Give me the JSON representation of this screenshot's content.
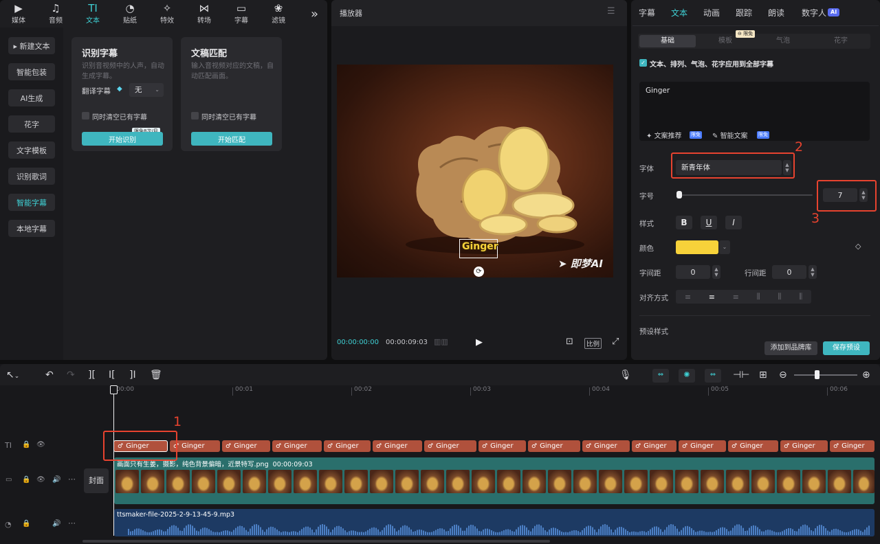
{
  "toolbar_top": [
    {
      "label": "媒体",
      "icon": "media-icon",
      "glyph": "▶"
    },
    {
      "label": "音频",
      "icon": "audio-icon",
      "glyph": "♫"
    },
    {
      "label": "文本",
      "icon": "text-icon",
      "glyph": "TI",
      "active": true
    },
    {
      "label": "贴纸",
      "icon": "sticker-icon",
      "glyph": "◔"
    },
    {
      "label": "特效",
      "icon": "effects-icon",
      "glyph": "✧"
    },
    {
      "label": "转场",
      "icon": "transition-icon",
      "glyph": "⋈"
    },
    {
      "label": "字幕",
      "icon": "subtitle-icon",
      "glyph": "▭"
    },
    {
      "label": "滤镜",
      "icon": "filter-icon",
      "glyph": "❀"
    }
  ],
  "toolbar_more_glyph": "»",
  "sidebar": [
    {
      "label": "▸ 新建文本"
    },
    {
      "label": "智能包装"
    },
    {
      "label": "AI生成"
    },
    {
      "label": "花字"
    },
    {
      "label": "文字模板"
    },
    {
      "label": "识别歌词"
    },
    {
      "label": "智能字幕",
      "active": true
    },
    {
      "label": "本地字幕"
    }
  ],
  "cards": {
    "recognize": {
      "title": "识别字幕",
      "desc": "识别音视频中的人声，自动生成字幕。",
      "translate_label": "翻译字幕",
      "translate_value": "无",
      "clear_label": "同时清空已有字幕",
      "badge": "限免8次/月",
      "button": "开始识别"
    },
    "match": {
      "title": "文稿匹配",
      "desc": "输入音视频对应的文稿，自动匹配画面。",
      "clear_label": "同时清空已有字幕",
      "button": "开始匹配"
    }
  },
  "player": {
    "title": "播放器",
    "caption": "Ginger",
    "watermark": "即梦AI",
    "time_current": "00:00:00:00",
    "time_total": "00:00:09:03",
    "ratio_label": "比例"
  },
  "right": {
    "tabs": [
      "字幕",
      "文本",
      "动画",
      "跟踪",
      "朗读",
      "数字人"
    ],
    "active_tab": "文本",
    "ai_badge": "AI",
    "subtabs": [
      "基础",
      "模板",
      "气泡",
      "花字"
    ],
    "free_badge": "限免",
    "apply_all": "文本、排列、气泡、花字应用到全部字幕",
    "text_value": "Ginger",
    "copy_suggest": "文案推荐",
    "smart_copy": "智能文案",
    "font_label": "字体",
    "font_value": "新青年体",
    "size_label": "字号",
    "size_value": "7",
    "style_label": "样式",
    "style_buttons": [
      "B",
      "U",
      "I"
    ],
    "color_label": "颜色",
    "color_value": "#f7d23a",
    "letter_spacing_label": "字间距",
    "letter_spacing_value": "0",
    "line_spacing_label": "行间距",
    "line_spacing_value": "0",
    "align_label": "对齐方式",
    "preset_label": "预设样式",
    "add_brand": "添加到品牌库",
    "save_preset": "保存预设"
  },
  "annotations": [
    "1",
    "2",
    "3"
  ],
  "timeline": {
    "ticks": [
      "00:00",
      "00:01",
      "00:02",
      "00:03",
      "00:04",
      "00:05",
      "00:06"
    ],
    "caption_clip": "Ginger",
    "video_label": "画面只有生姜，摄影，纯色背景偏暗，近景特写.png",
    "video_duration": "00:00:09:03",
    "cover_label": "封面",
    "audio_label": "ttsmaker-file-2025-2-9-13-45-9.mp3"
  },
  "accent": "#3fd0d4",
  "clip_color": "#b0513c",
  "annotation_color": "#e8432f"
}
